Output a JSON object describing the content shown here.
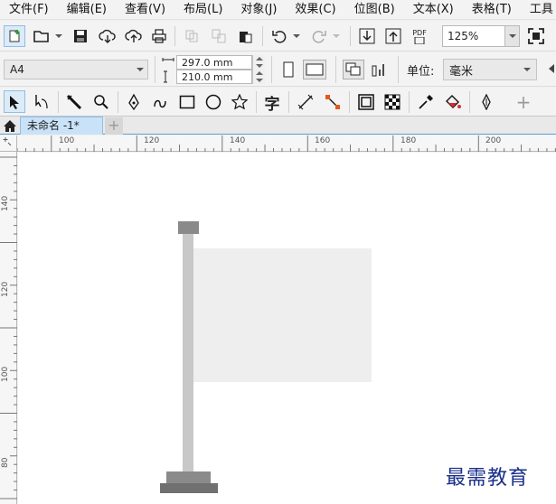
{
  "menu": [
    "文件(F)",
    "编辑(E)",
    "查看(V)",
    "布局(L)",
    "对象(J)",
    "效果(C)",
    "位图(B)",
    "文本(X)",
    "表格(T)",
    "工具"
  ],
  "toolbar1": {
    "pdf_label": "PDF",
    "zoom_value": "125%"
  },
  "toolbar2": {
    "page_size": "A4",
    "width_value": "297.0 mm",
    "height_value": "210.0 mm",
    "units_label": "单位:",
    "units_value": "毫米"
  },
  "toolbar3": {
    "text_tool_glyph": "字",
    "add_glyph": "+"
  },
  "tabs": {
    "document_name": "未命名 -1*",
    "add_label": "+"
  },
  "ruler_h": [
    "100",
    "120",
    "140",
    "160",
    "180",
    "200"
  ],
  "ruler_v": [
    "140",
    "120",
    "100",
    "80"
  ],
  "watermark": "最需教育",
  "colors": {
    "tab_active": "#c9e2f7",
    "accent": "#5aa0dc",
    "flag": "#eeeeee",
    "pole": "#c8c8c8",
    "base": "#7a7a7a"
  }
}
